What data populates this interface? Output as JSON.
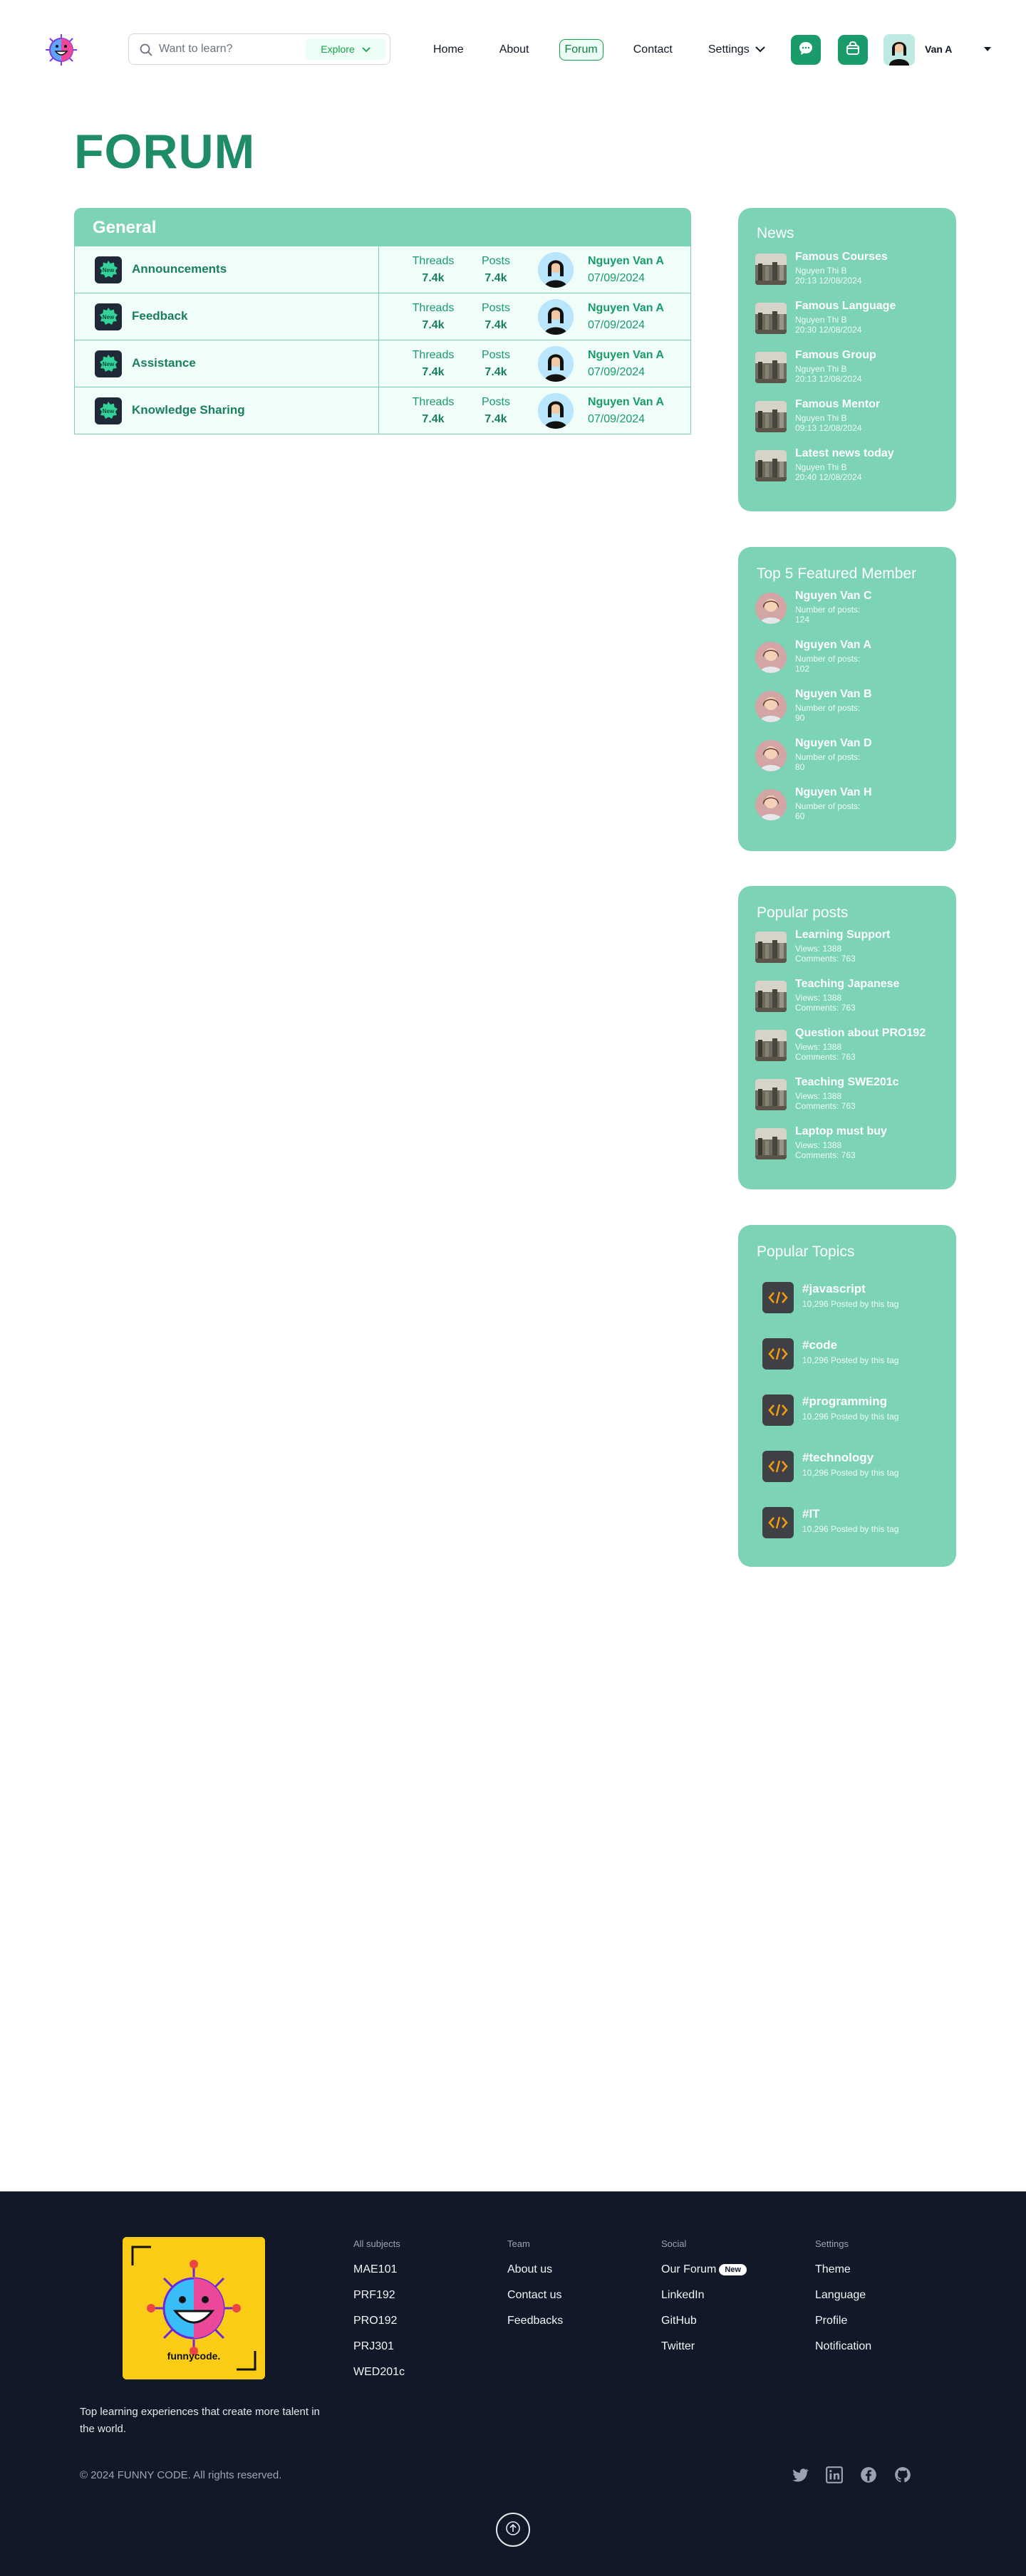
{
  "header": {
    "search_placeholder": "Want to learn?",
    "explore_label": "Explore",
    "nav": [
      {
        "label": "Home",
        "active": false
      },
      {
        "label": "About",
        "active": false
      },
      {
        "label": "Forum",
        "active": true
      },
      {
        "label": "Contact",
        "active": false
      }
    ],
    "settings_label": "Settings",
    "user_name": "Van A",
    "icons": [
      "logo",
      "search-icon",
      "chevron-down-icon",
      "chat-icon",
      "shop-icon",
      "avatar",
      "caret-down-icon"
    ]
  },
  "page_title": "FORUM",
  "forum": {
    "section_title": "General",
    "threads_label": "Threads",
    "posts_label": "Posts",
    "rows": [
      {
        "title": "Announcements",
        "threads": "7.4k",
        "posts": "7.4k",
        "user": "Nguyen Van A",
        "date": "07/09/2024",
        "icon_badge": "New"
      },
      {
        "title": "Feedback",
        "threads": "7.4k",
        "posts": "7.4k",
        "user": "Nguyen Van A",
        "date": "07/09/2024",
        "icon_badge": "New"
      },
      {
        "title": "Assistance",
        "threads": "7.4k",
        "posts": "7.4k",
        "user": "Nguyen Van A",
        "date": "07/09/2024",
        "icon_badge": "New"
      },
      {
        "title": "Knowledge Sharing",
        "threads": "7.4k",
        "posts": "7.4k",
        "user": "Nguyen Van A",
        "date": "07/09/2024",
        "icon_badge": "New"
      }
    ]
  },
  "news": {
    "title": "News",
    "items": [
      {
        "title": "Famous Courses",
        "author": "Nguyen Thi B",
        "time": "20:13  12/08/2024"
      },
      {
        "title": "Famous Language",
        "author": "Nguyen Thi B",
        "time": "20:30  12/08/2024"
      },
      {
        "title": "Famous Group",
        "author": "Nguyen Thi B",
        "time": "20:13  12/08/2024"
      },
      {
        "title": "Famous Mentor",
        "author": "Nguyen Thi B",
        "time": "09:13  12/08/2024"
      },
      {
        "title": "Latest news today",
        "author": "Nguyen Thi B",
        "time": "20:40  12/08/2024"
      }
    ]
  },
  "members": {
    "title": "Top 5 Featured Member",
    "posts_label": "Number of posts:",
    "items": [
      {
        "name": "Nguyen Van C",
        "posts": "124"
      },
      {
        "name": "Nguyen Van A",
        "posts": "102"
      },
      {
        "name": "Nguyen Van B",
        "posts": "90"
      },
      {
        "name": "Nguyen Van D",
        "posts": "80"
      },
      {
        "name": "Nguyen Van H",
        "posts": "60"
      }
    ]
  },
  "popular_posts": {
    "title": "Popular posts",
    "items": [
      {
        "title": "Learning Support",
        "views": "Views: 1388",
        "comments": "Comments: 763"
      },
      {
        "title": "Teaching Japanese",
        "views": "Views: 1388",
        "comments": "Comments: 763"
      },
      {
        "title": "Question about PRO192",
        "views": "Views: 1388",
        "comments": "Comments: 763"
      },
      {
        "title": "Teaching SWE201c",
        "views": "Views: 1388",
        "comments": "Comments: 763"
      },
      {
        "title": "Laptop must buy",
        "views": "Views: 1388",
        "comments": "Comments: 763"
      }
    ]
  },
  "popular_topics": {
    "title": "Popular Topics",
    "items": [
      {
        "tag": "#javascript",
        "sub": "10,296 Posted by this tag"
      },
      {
        "tag": "#code",
        "sub": "10,296 Posted by this tag"
      },
      {
        "tag": "#programming",
        "sub": "10,296 Posted by this tag"
      },
      {
        "tag": "#technology",
        "sub": "10,296 Posted by this tag"
      },
      {
        "tag": "#IT",
        "sub": "10,296 Posted by this tag"
      }
    ]
  },
  "footer": {
    "logo_text": "funnycode.",
    "columns": [
      {
        "head": "All subjects",
        "links": [
          "MAE101",
          "PRF192",
          "PRO192",
          "PRJ301",
          "WED201c"
        ]
      },
      {
        "head": "Team",
        "links": [
          "About us",
          "Contact us",
          "Feedbacks"
        ]
      },
      {
        "head": "Social",
        "links": [
          "Our Forum",
          "LinkedIn",
          "GitHub",
          "Twitter"
        ]
      },
      {
        "head": "Settings",
        "links": [
          "Theme",
          "Language",
          "Profile",
          "Notification"
        ]
      }
    ],
    "new_badge": "New",
    "tagline": "Top learning experiences that create more talent in the world.",
    "copyright": "© 2024 FUNNY CODE. All rights reserved.",
    "social_icons": [
      "twitter-icon",
      "linkedin-icon",
      "facebook-icon",
      "github-icon"
    ],
    "back_to_top_icon": "arrow-up-icon"
  },
  "colors": {
    "primary": "#1a9b6a",
    "title_green": "#1e8c66",
    "card_bg": "#7dd3b5",
    "row_bg": "#f0fdf8",
    "footer_bg": "#111827"
  }
}
